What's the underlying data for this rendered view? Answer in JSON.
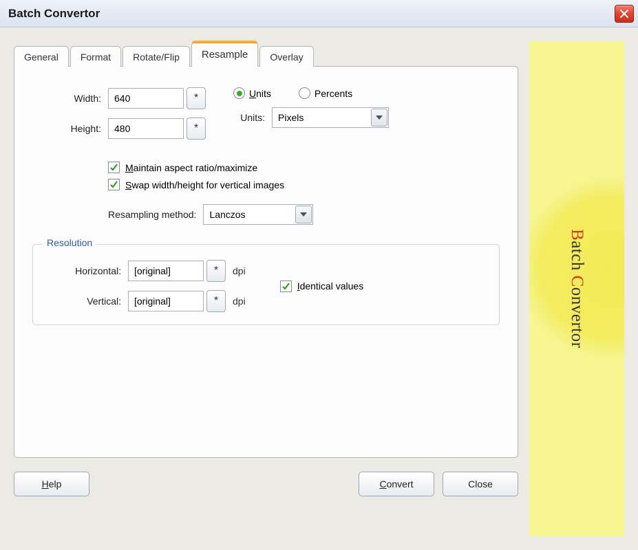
{
  "title": "Batch Convertor",
  "tabs": {
    "general": "General",
    "format": "Format",
    "rotate": "Rotate/Flip",
    "resample": "Resample",
    "overlay": "Overlay"
  },
  "labels": {
    "width": "Width:",
    "height": "Height:",
    "units": "Units:",
    "resampling_method": "Resampling method:",
    "horizontal": "Horizontal:",
    "vertical": "Vertical:",
    "dpi": "dpi"
  },
  "values": {
    "width": "640",
    "height": "480",
    "units_select": "Pixels",
    "method_select": "Lanczos",
    "horizontal": "[original]",
    "vertical": "[original]"
  },
  "radios": {
    "units_u": "U",
    "units_rest": "nits",
    "percents": "Percents"
  },
  "checks": {
    "maintain_m": "M",
    "maintain_rest": "aintain aspect ratio/maximize",
    "swap_s": "S",
    "swap_rest": "wap width/height for vertical images",
    "identical_i": "I",
    "identical_rest": "dentical values"
  },
  "fieldset": {
    "resolution": "Resolution"
  },
  "buttons": {
    "star": "*",
    "help_h": "H",
    "help_rest": "elp",
    "convert_c": "C",
    "convert_rest": "onvert",
    "close": "Close"
  },
  "banner": {
    "b": "B",
    "atch": "atch ",
    "c": "C",
    "onvertor": "onvertor"
  }
}
